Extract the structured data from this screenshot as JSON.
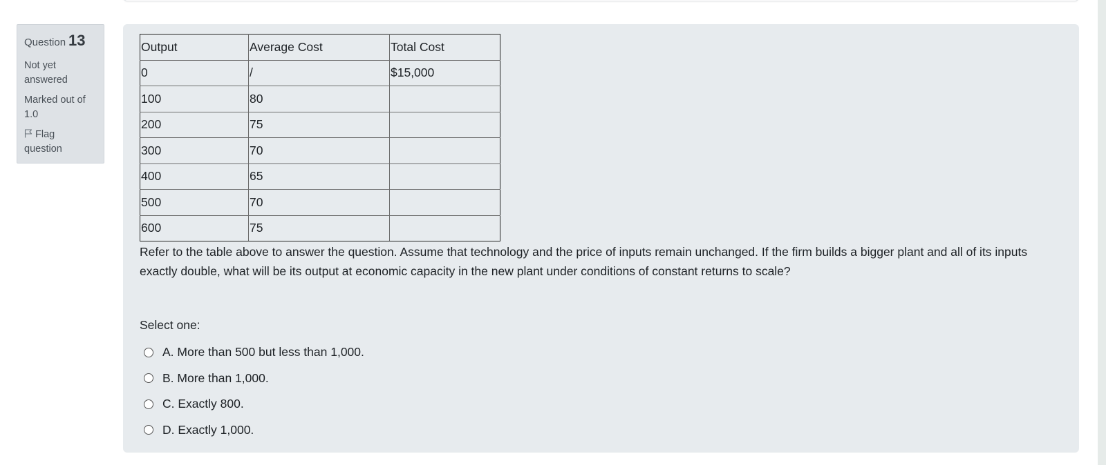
{
  "question_info": {
    "label": "Question",
    "number": "13",
    "state_line1": "Not yet",
    "state_line2": "answered",
    "mark_line1": "Marked out of",
    "mark_line2": "1.0",
    "flag_line1": "Flag",
    "flag_line2": "question",
    "flag_icon": "flag-outline-icon"
  },
  "cost_table": {
    "headers": [
      "Output",
      "Average Cost",
      "Total Cost"
    ],
    "rows": [
      [
        "0",
        "/",
        "$15,000"
      ],
      [
        "100",
        "80",
        ""
      ],
      [
        "200",
        "75",
        ""
      ],
      [
        "300",
        "70",
        ""
      ],
      [
        "400",
        "65",
        ""
      ],
      [
        "500",
        "70",
        ""
      ],
      [
        "600",
        "75",
        ""
      ]
    ]
  },
  "question": {
    "text": "Refer to the table above to answer the question. Assume that technology and the price of inputs remain unchanged. If the firm builds a bigger plant and all of its inputs exactly double, what will be its output at economic capacity in the new plant under conditions of constant returns to scale?",
    "prompt": "Select one:",
    "options": [
      {
        "letter": "A.",
        "text": "More than 500 but less than 1,000."
      },
      {
        "letter": "B.",
        "text": "More than 1,000."
      },
      {
        "letter": "C.",
        "text": "Exactly 800."
      },
      {
        "letter": "D.",
        "text": "Exactly 1,000."
      }
    ]
  }
}
